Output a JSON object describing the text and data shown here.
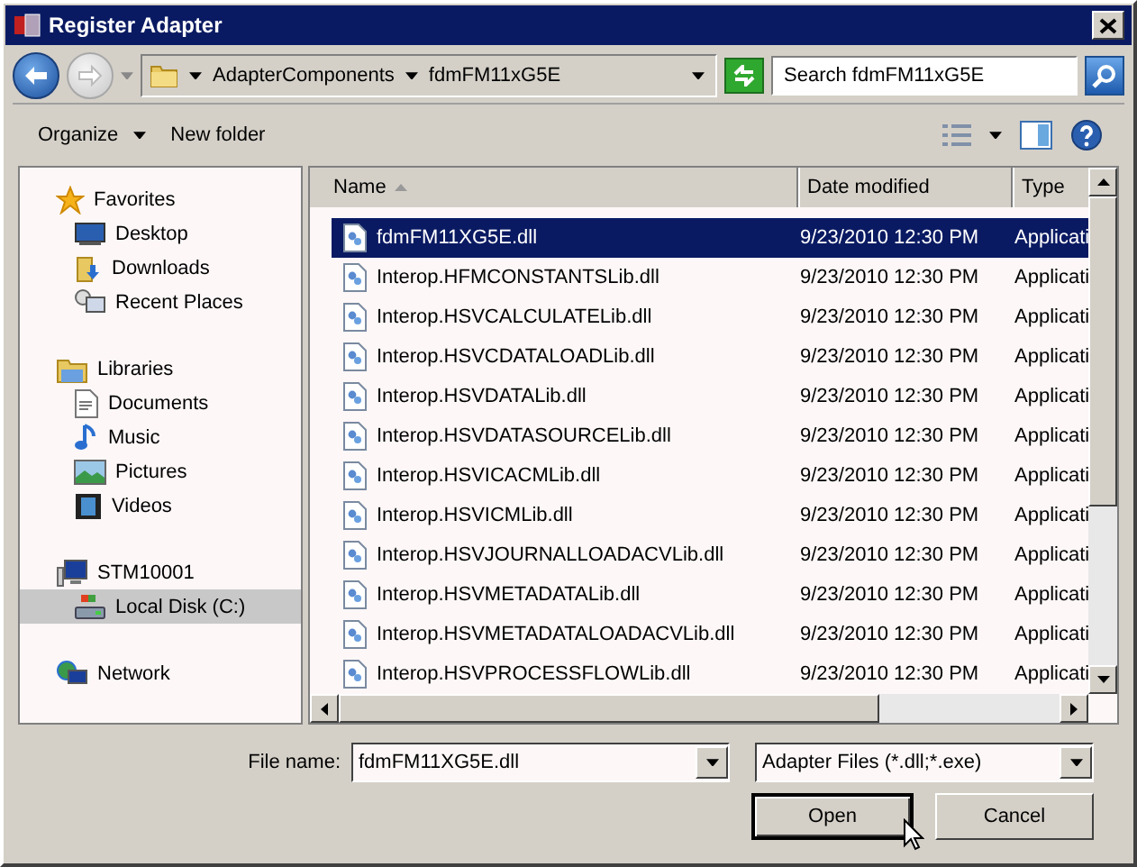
{
  "window": {
    "title": "Register Adapter"
  },
  "address": {
    "breadcrumb": [
      "AdapterComponents",
      "fdmFM11xG5E"
    ],
    "search": {
      "placeholder": "Search fdmFM11xG5E"
    }
  },
  "toolbar": {
    "buttons": [
      {
        "label": "Organize",
        "menu": true
      },
      {
        "label": "New folder",
        "menu": false
      }
    ]
  },
  "sidebar": {
    "groups": [
      {
        "label": "Favorites",
        "items": [
          {
            "label": "Desktop",
            "selected": false
          },
          {
            "label": "Downloads",
            "selected": false
          },
          {
            "label": "Recent Places",
            "selected": false
          }
        ]
      },
      {
        "label": "Libraries",
        "items": [
          {
            "label": "Documents",
            "selected": false
          },
          {
            "label": "Music",
            "selected": false
          },
          {
            "label": "Pictures",
            "selected": false
          },
          {
            "label": "Videos",
            "selected": false
          }
        ]
      },
      {
        "label": "STM10001",
        "items": [
          {
            "label": "Local Disk (C:)",
            "selected": true
          }
        ]
      },
      {
        "label": "Network"
      }
    ]
  },
  "table": {
    "columns": [
      {
        "label": "Name",
        "sorted": true
      },
      {
        "label": "Date modified",
        "sorted": false
      },
      {
        "label": "Type",
        "sorted": false
      }
    ],
    "rows": [
      {
        "name": "fdmFM11XG5E.dll",
        "date": "9/23/2010 12:30 PM",
        "type": "Applicati",
        "selected": true
      },
      {
        "name": "Interop.HFMCONSTANTSLib.dll",
        "date": "9/23/2010 12:30 PM",
        "type": "Applicati",
        "selected": false
      },
      {
        "name": "Interop.HSVCALCULATELib.dll",
        "date": "9/23/2010 12:30 PM",
        "type": "Applicati",
        "selected": false
      },
      {
        "name": "Interop.HSVCDATALOADLib.dll",
        "date": "9/23/2010 12:30 PM",
        "type": "Applicati",
        "selected": false
      },
      {
        "name": "Interop.HSVDATALib.dll",
        "date": "9/23/2010 12:30 PM",
        "type": "Applicati",
        "selected": false
      },
      {
        "name": "Interop.HSVDATASOURCELib.dll",
        "date": "9/23/2010 12:30 PM",
        "type": "Applicati",
        "selected": false
      },
      {
        "name": "Interop.HSVICACMLib.dll",
        "date": "9/23/2010 12:30 PM",
        "type": "Applicati",
        "selected": false
      },
      {
        "name": "Interop.HSVICMLib.dll",
        "date": "9/23/2010 12:30 PM",
        "type": "Applicati",
        "selected": false
      },
      {
        "name": "Interop.HSVJOURNALLOADACVLib.dll",
        "date": "9/23/2010 12:30 PM",
        "type": "Applicati",
        "selected": false
      },
      {
        "name": "Interop.HSVMETADATALib.dll",
        "date": "9/23/2010 12:30 PM",
        "type": "Applicati",
        "selected": false
      },
      {
        "name": "Interop.HSVMETADATALOADACVLib.dll",
        "date": "9/23/2010 12:30 PM",
        "type": "Applicati",
        "selected": false
      },
      {
        "name": "Interop.HSVPROCESSFLOWLib.dll",
        "date": "9/23/2010 12:30 PM",
        "type": "Applicati",
        "selected": false
      }
    ]
  },
  "footer": {
    "file_name": {
      "label": "File name:",
      "value": "fdmFM11XG5E.dll"
    },
    "file_type": {
      "value": "Adapter Files (*.dll;*.exe)"
    },
    "buttons": [
      {
        "label": "Open",
        "default": true
      },
      {
        "label": "Cancel",
        "default": false
      }
    ]
  }
}
